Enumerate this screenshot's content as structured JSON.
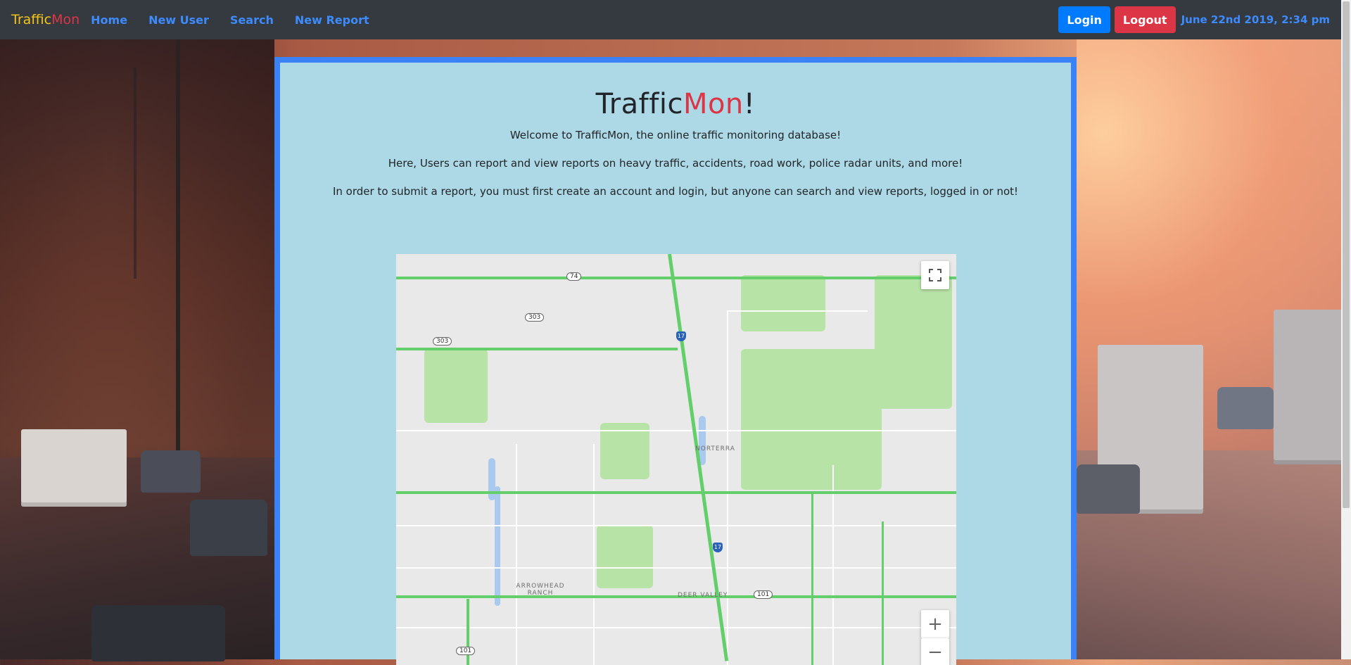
{
  "nav": {
    "brand_part1": "Traffic",
    "brand_part2": "Mon",
    "links": [
      "Home",
      "New User",
      "Search",
      "New Report"
    ],
    "login_label": "Login",
    "logout_label": "Logout",
    "datetime": "June 22nd 2019, 2:34 pm"
  },
  "main": {
    "title_part1": "Traffic",
    "title_part2": "Mon",
    "title_suffix": "!",
    "welcome": "Welcome to TrafficMon, the online traffic monitoring database!",
    "description": "Here, Users can report and view reports on heavy traffic, accidents, road work, police radar units, and more!",
    "instructions": "In order to submit a report, you must first create an account and login, but anyone can search and view reports, logged in or not!"
  },
  "map": {
    "labels": [
      "NORTERRA",
      "ARROWHEAD RANCH",
      "DEER VALLEY"
    ],
    "shields": [
      "74",
      "303",
      "303",
      "17",
      "17",
      "101",
      "101"
    ],
    "fullscreen_icon": "fullscreen-icon",
    "zoom_in": "+",
    "zoom_out": "−",
    "colors": {
      "traffic_flow": "#63cf6a",
      "park": "#b8e3a6",
      "water": "#a9c9ee",
      "land": "#e9e9e9"
    }
  },
  "colors": {
    "navbar": "#343a40",
    "link": "#3d8bfd",
    "accent_red": "#dc3545",
    "card_bg": "#add8e6",
    "card_border": "#3b82f6"
  }
}
